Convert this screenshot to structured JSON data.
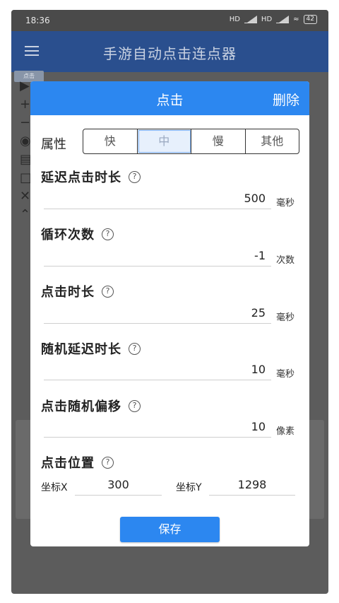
{
  "status_bar": {
    "time": "18:36",
    "net1": "HD",
    "net2": "HD",
    "battery": "42"
  },
  "app_bar": {
    "title": "手游自动点击连点器"
  },
  "background": {
    "chip": "点击"
  },
  "dialog": {
    "title": "点击",
    "delete_label": "删除",
    "attribute": {
      "label": "属性",
      "options": [
        "快",
        "中",
        "慢",
        "其他"
      ],
      "selected": "中"
    },
    "help_glyph": "?",
    "fields": [
      {
        "label": "延迟点击时长",
        "value": "500",
        "unit": "毫秒"
      },
      {
        "label": "循环次数",
        "value": "-1",
        "unit": "次数"
      },
      {
        "label": "点击时长",
        "value": "25",
        "unit": "毫秒"
      },
      {
        "label": "随机延迟时长",
        "value": "10",
        "unit": "毫秒"
      },
      {
        "label": "点击随机偏移",
        "value": "10",
        "unit": "像素"
      }
    ],
    "position": {
      "label": "点击位置",
      "x_label": "坐标X",
      "x_value": "300",
      "y_label": "坐标Y",
      "y_value": "1298"
    },
    "save_label": "保存"
  },
  "colors": {
    "accent": "#2c87f0",
    "app_bar": "#2a4f8e",
    "overlay": "#5c5c5c"
  }
}
